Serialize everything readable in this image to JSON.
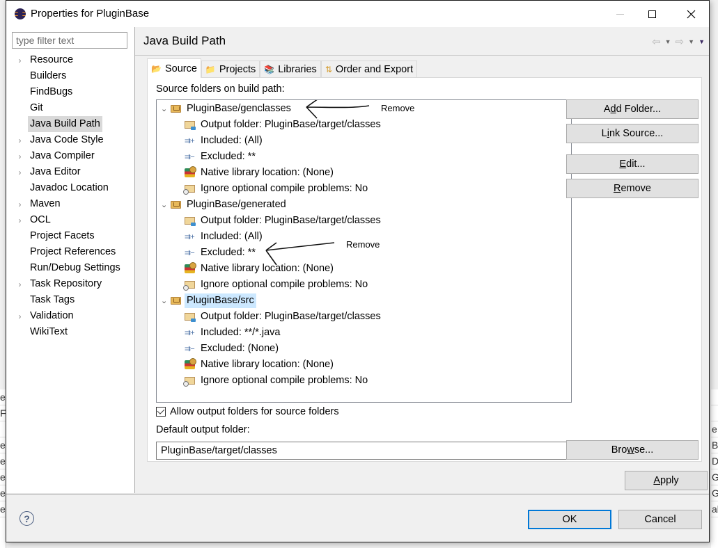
{
  "window": {
    "title": "Properties for PluginBase",
    "app_icon": "eclipse-icon",
    "controls": {
      "minimize": "minimize-icon",
      "maximize": "maximize-icon",
      "close": "close-icon"
    }
  },
  "sidebar": {
    "filter_placeholder": "type filter text",
    "filter_value": "",
    "items": [
      {
        "label": "Resource",
        "expandable": true
      },
      {
        "label": "Builders",
        "expandable": false
      },
      {
        "label": "FindBugs",
        "expandable": false
      },
      {
        "label": "Git",
        "expandable": false
      },
      {
        "label": "Java Build Path",
        "expandable": false,
        "selected": true
      },
      {
        "label": "Java Code Style",
        "expandable": true
      },
      {
        "label": "Java Compiler",
        "expandable": true
      },
      {
        "label": "Java Editor",
        "expandable": true
      },
      {
        "label": "Javadoc Location",
        "expandable": false
      },
      {
        "label": "Maven",
        "expandable": true
      },
      {
        "label": "OCL",
        "expandable": true
      },
      {
        "label": "Project Facets",
        "expandable": false
      },
      {
        "label": "Project References",
        "expandable": false
      },
      {
        "label": "Run/Debug Settings",
        "expandable": false
      },
      {
        "label": "Task Repository",
        "expandable": true
      },
      {
        "label": "Task Tags",
        "expandable": false
      },
      {
        "label": "Validation",
        "expandable": true
      },
      {
        "label": "WikiText",
        "expandable": false
      }
    ]
  },
  "page": {
    "title": "Java Build Path",
    "nav": {
      "back": "back-arrow-icon",
      "forward": "forward-arrow-icon",
      "menu": "view-menu-icon"
    }
  },
  "tabs": [
    {
      "label": "Source",
      "icon": "source-folder-icon",
      "active": true
    },
    {
      "label": "Projects",
      "icon": "project-folder-icon",
      "active": false
    },
    {
      "label": "Libraries",
      "icon": "libraries-icon",
      "active": false
    },
    {
      "label": "Order and Export",
      "icon": "order-export-icon",
      "active": false
    }
  ],
  "source_tab": {
    "tree_label": "Source folders on build path:",
    "folders": [
      {
        "name": "PluginBase/genclasses",
        "expanded": true,
        "selected": false,
        "children": [
          "Output folder: PluginBase/target/classes",
          "Included: (All)",
          "Excluded: **",
          "Native library location: (None)",
          "Ignore optional compile problems: No"
        ]
      },
      {
        "name": "PluginBase/generated",
        "expanded": true,
        "selected": false,
        "children": [
          "Output folder: PluginBase/target/classes",
          "Included: (All)",
          "Excluded: **",
          "Native library location: (None)",
          "Ignore optional compile problems: No"
        ]
      },
      {
        "name": "PluginBase/src",
        "expanded": true,
        "selected": true,
        "children": [
          "Output folder: PluginBase/target/classes",
          "Included: **/*.java",
          "Excluded: (None)",
          "Native library location: (None)",
          "Ignore optional compile problems: No"
        ]
      }
    ],
    "annotations": [
      {
        "text": "Remove",
        "points_to": "PluginBase/genclasses"
      },
      {
        "text": "Remove",
        "points_to": "PluginBase/generated > Excluded: **"
      }
    ],
    "buttons": {
      "add_folder": "Add Folder...",
      "link_source": "Link Source...",
      "edit": "Edit...",
      "remove": "Remove",
      "browse": "Browse..."
    },
    "allow_output_folders": {
      "label": "Allow output folders for source folders",
      "checked": true
    },
    "default_output_label": "Default output folder:",
    "default_output_value": "PluginBase/target/classes"
  },
  "footer": {
    "apply": "Apply",
    "ok": "OK",
    "cancel": "Cancel",
    "help": "?"
  },
  "background": {
    "left_fragments": [
      "e",
      "Fi",
      "",
      "e",
      "e",
      "e",
      "e",
      "e"
    ],
    "right_fragments": [
      "",
      "",
      "e",
      "B",
      "D",
      "G",
      "G",
      "ab"
    ]
  }
}
